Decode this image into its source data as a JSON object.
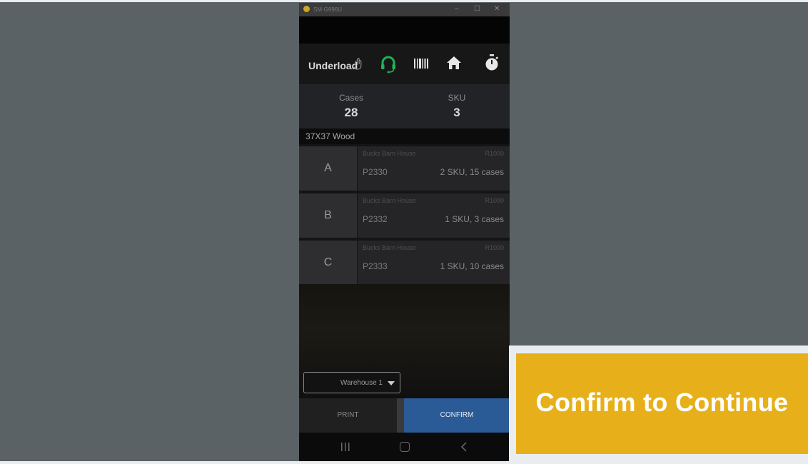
{
  "window": {
    "title": "SM-G996U",
    "minimize": "–",
    "maximize": "☐",
    "close": "✕"
  },
  "appbar": {
    "title": "Underload",
    "icons": [
      "hand-icon",
      "headset-icon",
      "barcode-icon",
      "home-icon",
      "timer-icon"
    ],
    "headset_color": "#1db35a"
  },
  "stats": {
    "cases_label": "Cases",
    "cases_value": "28",
    "sku_label": "SKU",
    "sku_value": "3"
  },
  "group_label": "37X37 Wood",
  "orders": [
    {
      "letter": "A",
      "customer": "Bucks Barn House",
      "ref": "R1000",
      "code": "P2330",
      "summary": "2 SKU, 15 cases"
    },
    {
      "letter": "B",
      "customer": "Bucks Barn House",
      "ref": "R1000",
      "code": "P2332",
      "summary": "1 SKU, 3 cases"
    },
    {
      "letter": "C",
      "customer": "Bucks Barn House",
      "ref": "R1000",
      "code": "P2333",
      "summary": "1 SKU, 10 cases"
    }
  ],
  "warehouse_select": {
    "selected": "Warehouse 1"
  },
  "buttons": {
    "print": "PRINT",
    "confirm": "CONFIRM"
  },
  "callout": {
    "text": "Confirm to Continue",
    "color": "#e7b01a"
  },
  "colors": {
    "confirm": "#2a5b96",
    "background": "#5b6266"
  }
}
